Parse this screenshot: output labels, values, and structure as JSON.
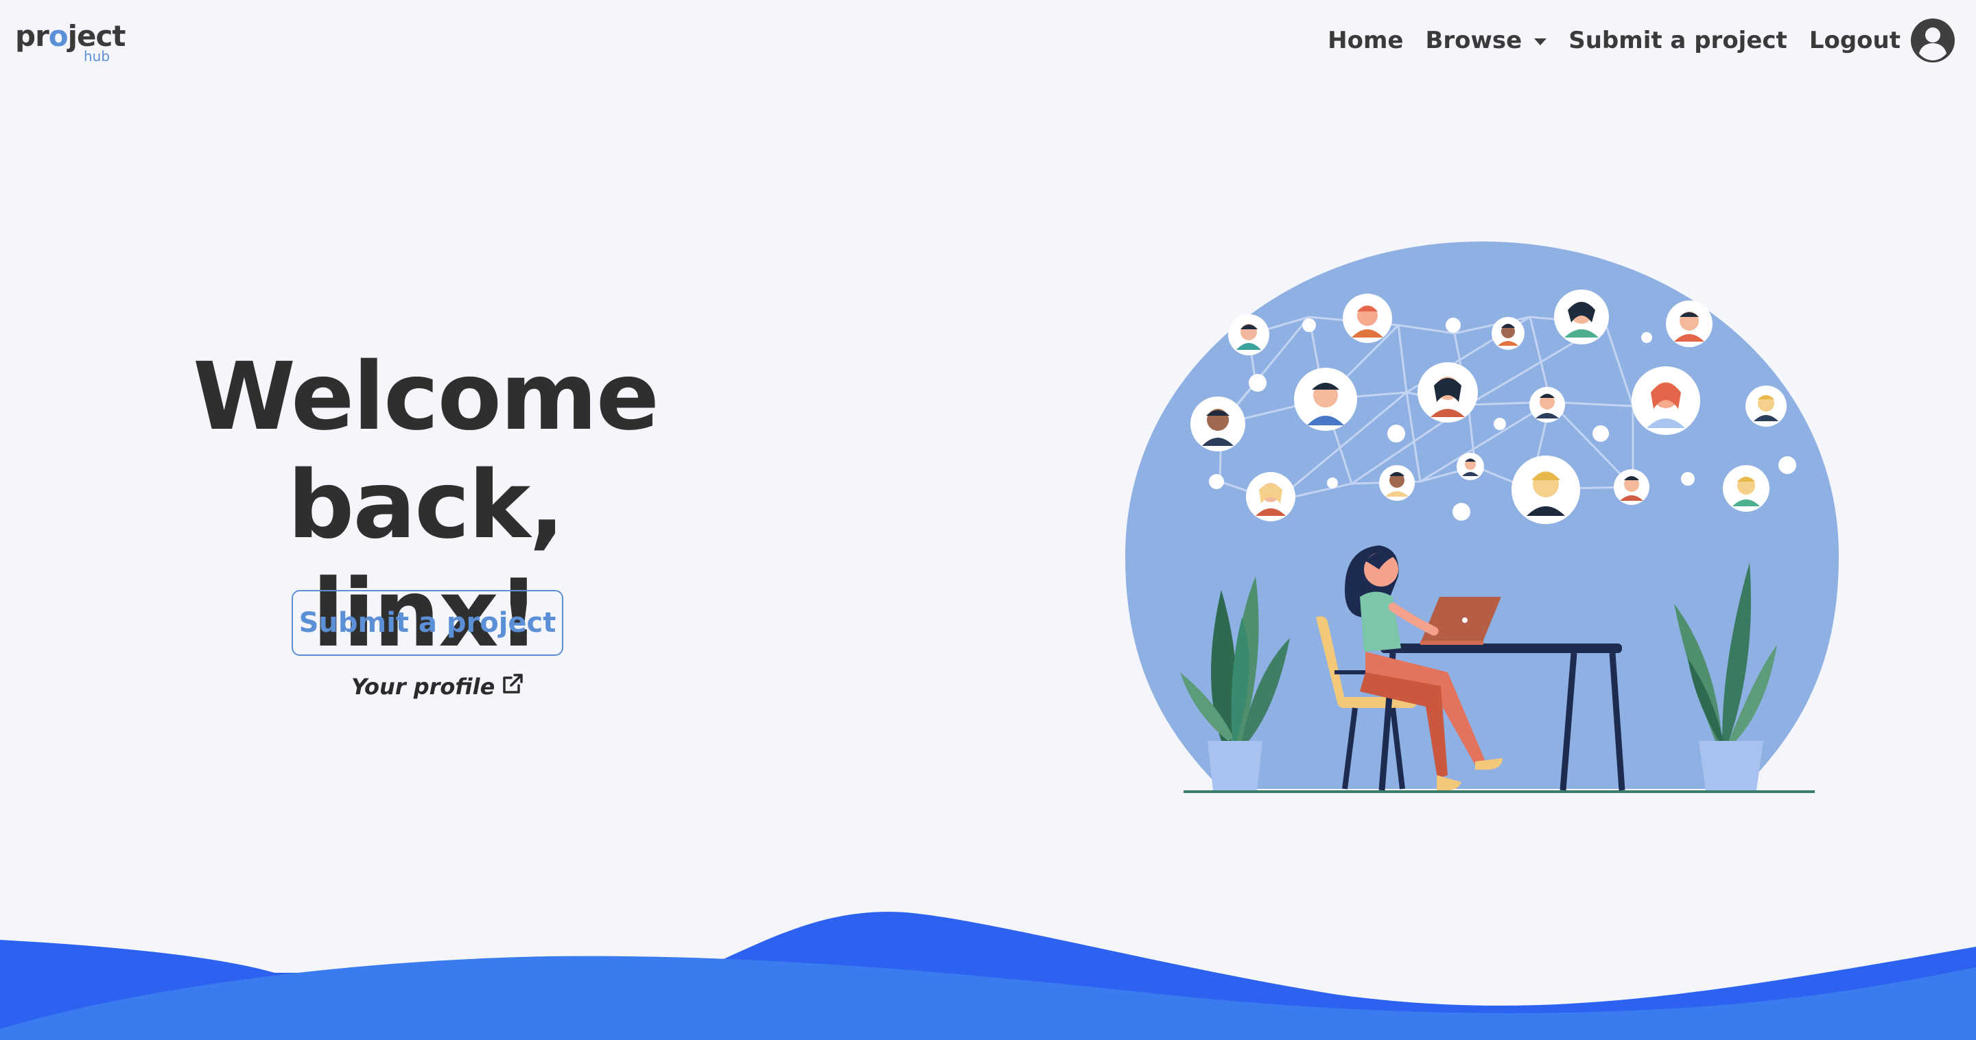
{
  "brand": {
    "logo_main_pre": "pr",
    "logo_main_o": "o",
    "logo_main_post": "ject",
    "logo_sub": "hub"
  },
  "nav": {
    "home": "Home",
    "browse": "Browse",
    "submit": "Submit a project",
    "logout": "Logout"
  },
  "hero": {
    "title_line1": "Welcome back,",
    "title_line2": "linx!",
    "cta_label": "Submit a project",
    "profile_label": "Your profile"
  },
  "colors": {
    "accent": "#5b8fd6",
    "wave_dark": "#2d62f0",
    "wave_light": "#3b7cf0",
    "illus_bg": "#8fb0e3"
  },
  "icons": {
    "account": "user-circle-icon",
    "external": "external-link-icon",
    "dropdown": "chevron-down-icon"
  }
}
